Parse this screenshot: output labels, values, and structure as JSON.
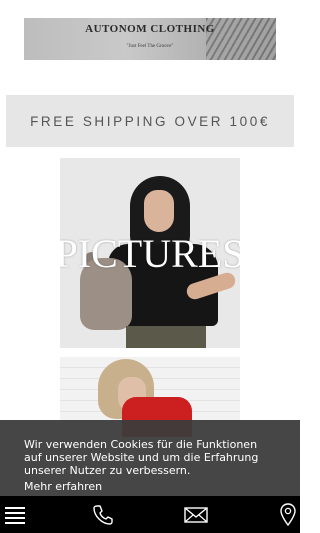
{
  "logo": {
    "title": "AUTONOM CLOTHING",
    "tagline": "\"Just Feel The Groove\""
  },
  "shipping_banner": {
    "text": "FREE SHIPPING OVER 100€"
  },
  "images": [
    {
      "overlay_text": "PICTURES"
    },
    {}
  ],
  "cookie_banner": {
    "text": "Wir verwenden Cookies für die Funktionen auf unserer Website und um die Erfahrung unserer Nutzer zu verbessern.",
    "link": "Mehr erfahren"
  },
  "bottom_nav": {
    "background": "#000000",
    "items": [
      {
        "icon": "menu-icon"
      },
      {
        "icon": "phone-icon"
      },
      {
        "icon": "mail-icon"
      },
      {
        "icon": "location-icon"
      }
    ]
  },
  "colors": {
    "shipping_banner_bg": "#e6e6e6",
    "cookie_banner_bg": "#3c3c3c"
  }
}
